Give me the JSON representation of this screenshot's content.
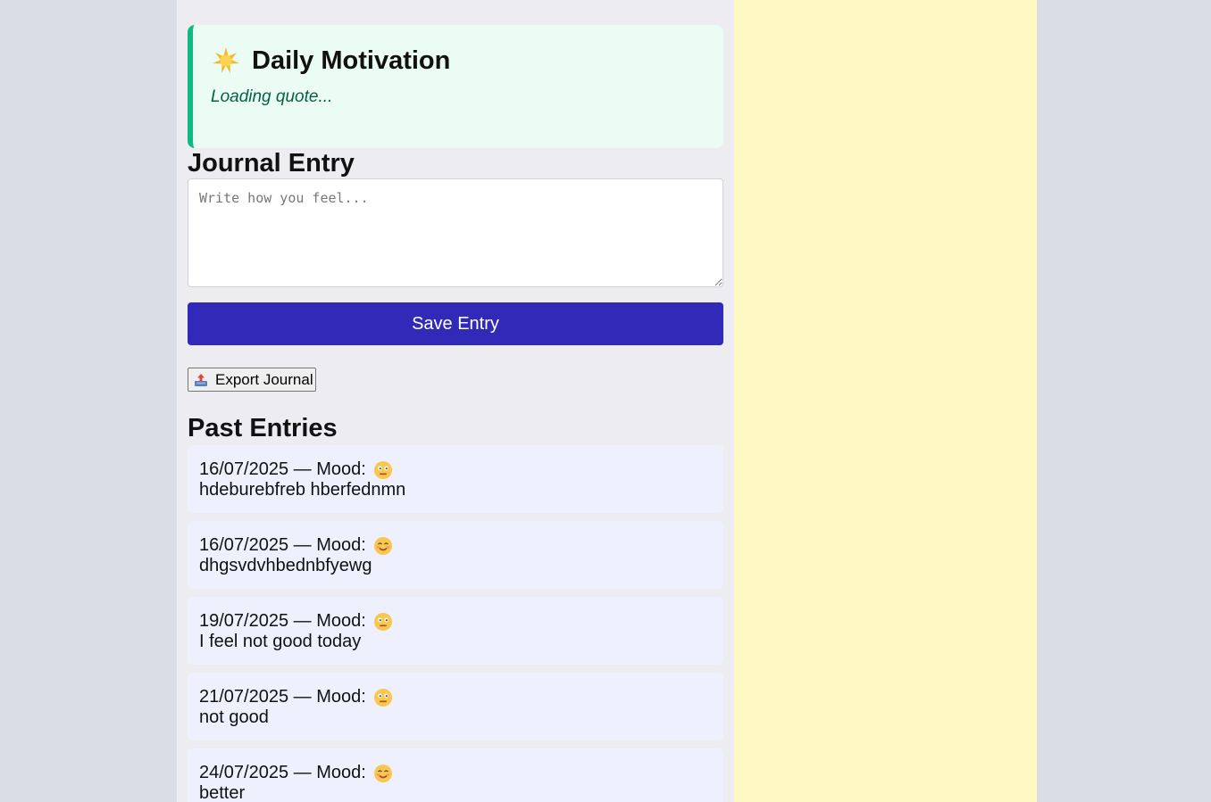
{
  "motivation": {
    "title": "Daily Motivation",
    "icon": "star-icon",
    "quote": "Loading quote..."
  },
  "journal": {
    "heading": "Journal Entry",
    "placeholder": "Write how you feel...",
    "value": "",
    "save_label": "Save Entry"
  },
  "export": {
    "label": "Export Journal",
    "icon": "outbox-tray-icon"
  },
  "past": {
    "heading": "Past Entries",
    "entries": [
      {
        "meta": "16/07/2025 — Mood:",
        "mood": "neutral-face-icon",
        "text": "hdeburebfreb hberfednmn"
      },
      {
        "meta": "16/07/2025 — Mood:",
        "mood": "smiling-face-icon",
        "text": "dhgsvdvhbednbfyewg"
      },
      {
        "meta": "19/07/2025 — Mood:",
        "mood": "neutral-face-icon",
        "text": "I feel not good today"
      },
      {
        "meta": "21/07/2025 — Mood:",
        "mood": "neutral-face-icon",
        "text": "not good"
      },
      {
        "meta": "24/07/2025 — Mood:",
        "mood": "smiling-face-icon",
        "text": "better"
      }
    ]
  },
  "colors": {
    "accent": "#312ab8",
    "quote_border": "#10b981",
    "quote_text": "#065f46",
    "right_panel": "#fef9c3"
  }
}
